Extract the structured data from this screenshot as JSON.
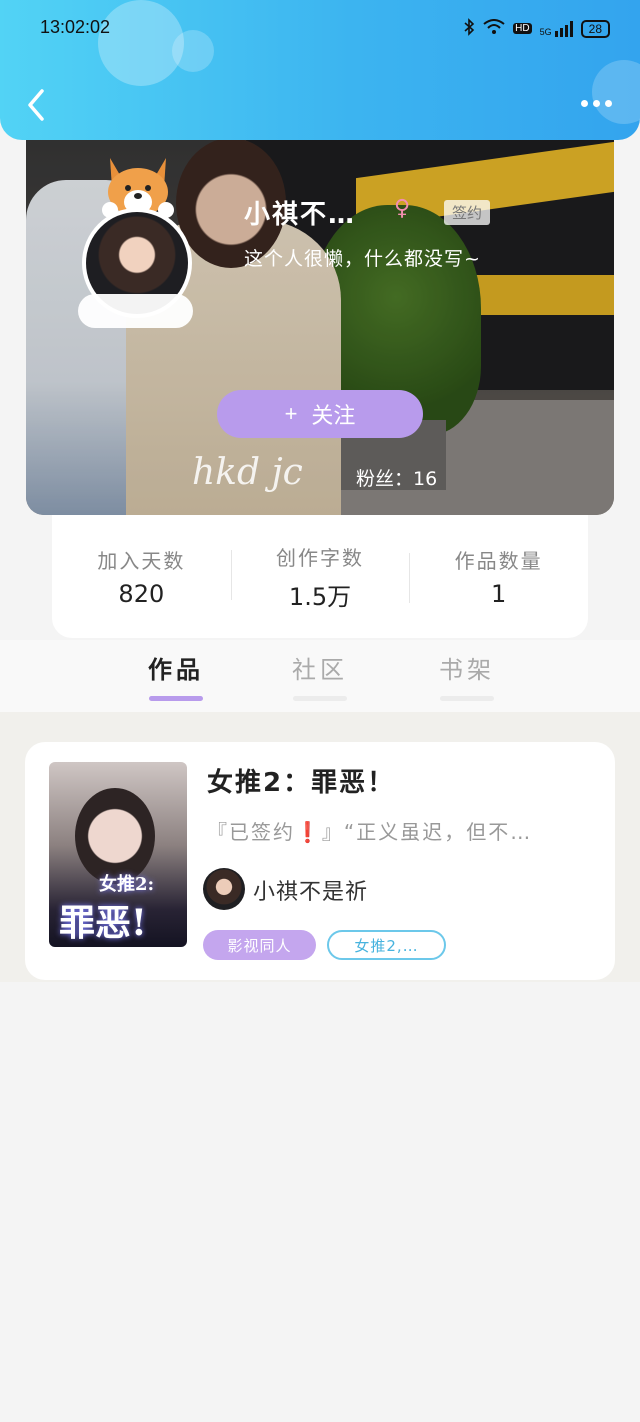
{
  "status_bar": {
    "time": "13:02:02",
    "network": "5G",
    "hd": "HD",
    "battery": "28"
  },
  "header": {
    "back_icon": "chevron-left-icon",
    "more_icon": "more-horizontal-icon"
  },
  "profile": {
    "name": "小祺不…",
    "gender_symbol": "♀",
    "badge": "签约",
    "bio": "这个人很懒，什么都没写~",
    "follow_plus": "+",
    "follow_label": "关注",
    "watermark": "hkd jc",
    "fans_label": "粉丝：",
    "fans_count": "16"
  },
  "stats": [
    {
      "label": "加入天数",
      "value": "820"
    },
    {
      "label": "创作字数",
      "value": "1.5万"
    },
    {
      "label": "作品数量",
      "value": "1"
    }
  ],
  "tabs": [
    {
      "label": "作品",
      "active": true
    },
    {
      "label": "社区",
      "active": false
    },
    {
      "label": "书架",
      "active": false
    }
  ],
  "works": [
    {
      "title": "女推2：罪恶！",
      "desc_prefix": "『已签约",
      "desc_mark": "❗",
      "desc_suffix": "』“正义虽迟，但不…",
      "cover_title_line1": "女推2:",
      "cover_title_line2": "罪恶!",
      "author": "小祺不是祈",
      "tags": [
        "影视同人",
        "女推2,…"
      ]
    }
  ],
  "colors": {
    "header_gradient_start": "#52d3f5",
    "header_gradient_end": "#33a4ee",
    "accent_purple": "#b89bec",
    "tag_blue": "#47b3de"
  }
}
